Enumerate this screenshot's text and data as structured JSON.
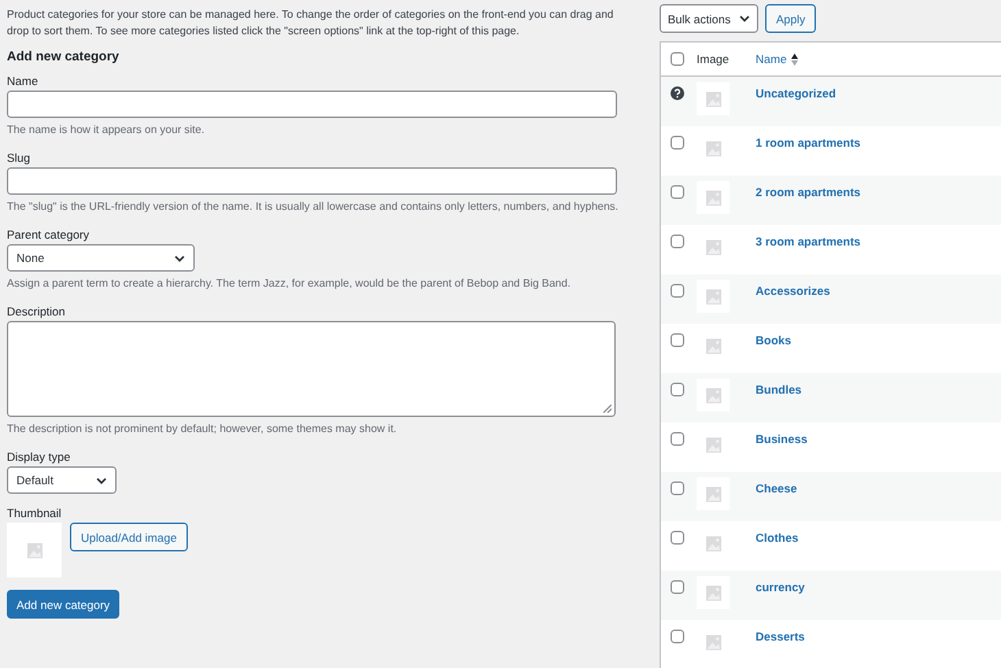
{
  "intro": "Product categories for your store can be managed here. To change the order of categories on the front-end you can drag and drop to sort them. To see more categories listed click the \"screen options\" link at the top-right of this page.",
  "form": {
    "title": "Add new category",
    "fields": [
      {
        "kind": "text",
        "label": "Name",
        "hint": "The name is how it appears on your site."
      },
      {
        "kind": "text",
        "label": "Slug",
        "hint": "The \"slug\" is the URL-friendly version of the name. It is usually all lowercase and contains only letters, numbers, and hyphens."
      },
      {
        "kind": "select",
        "label": "Parent category",
        "value": "None",
        "hint": "Assign a parent term to create a hierarchy. The term Jazz, for example, would be the parent of Bebop and Big Band."
      },
      {
        "kind": "textarea",
        "label": "Description",
        "hint": "The description is not prominent by default; however, some themes may show it."
      },
      {
        "kind": "select-small",
        "label": "Display type",
        "value": "Default"
      },
      {
        "kind": "thumbnail",
        "label": "Thumbnail",
        "button": "Upload/Add image"
      }
    ],
    "submit": "Add new category"
  },
  "bulk": {
    "select": "Bulk actions",
    "apply": "Apply"
  },
  "table": {
    "select_all_checked": false,
    "columns": [
      "Image",
      "Name"
    ],
    "rows": [
      {
        "kind": "default",
        "name": "Uncategorized"
      },
      {
        "kind": "checkbox",
        "checked": false,
        "name": "1 room apartments"
      },
      {
        "kind": "checkbox",
        "checked": false,
        "name": "2 room apartments"
      },
      {
        "kind": "checkbox",
        "checked": false,
        "name": "3 room apartments"
      },
      {
        "kind": "checkbox",
        "checked": false,
        "name": "Accessorizes"
      },
      {
        "kind": "checkbox",
        "checked": false,
        "name": "Books"
      },
      {
        "kind": "checkbox",
        "checked": false,
        "name": "Bundles"
      },
      {
        "kind": "checkbox",
        "checked": false,
        "name": "Business"
      },
      {
        "kind": "checkbox",
        "checked": false,
        "name": "Cheese"
      },
      {
        "kind": "checkbox",
        "checked": false,
        "name": "Clothes"
      },
      {
        "kind": "checkbox",
        "checked": false,
        "name": "currency"
      },
      {
        "kind": "checkbox",
        "checked": false,
        "name": "Desserts"
      }
    ]
  }
}
